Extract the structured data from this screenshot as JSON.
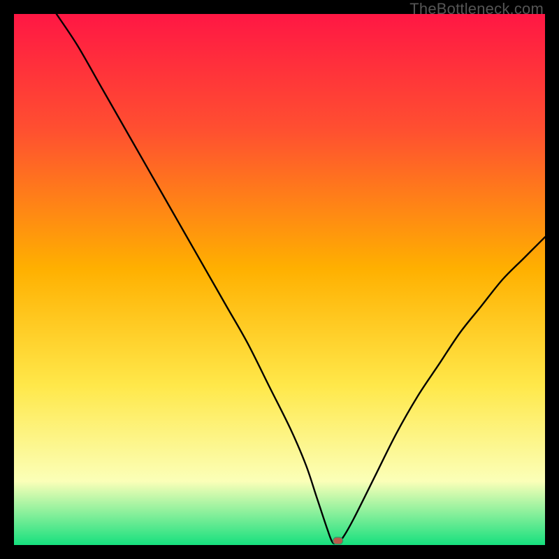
{
  "watermark": "TheBottleneck.com",
  "colors": {
    "gradient_top": "#ff1744",
    "gradient_upper": "#ff5030",
    "gradient_mid": "#ffb000",
    "gradient_lower": "#ffe84a",
    "gradient_pale": "#fbffb8",
    "gradient_bottom": "#16e07e",
    "curve": "#000000",
    "marker_fill": "#bb5b4c",
    "marker_stroke": "#2aa06b",
    "frame": "#000000"
  },
  "chart_data": {
    "type": "line",
    "title": "",
    "xlabel": "",
    "ylabel": "",
    "xlim": [
      0,
      100
    ],
    "ylim": [
      0,
      100
    ],
    "series": [
      {
        "name": "bottleneck-curve",
        "x": [
          8,
          12,
          16,
          20,
          24,
          28,
          32,
          36,
          40,
          44,
          48,
          52,
          55,
          57,
          59,
          60,
          61,
          62,
          64,
          68,
          72,
          76,
          80,
          84,
          88,
          92,
          96,
          100
        ],
        "y": [
          100,
          94,
          87,
          80,
          73,
          66,
          59,
          52,
          45,
          38,
          30,
          22,
          15,
          9,
          3,
          0.5,
          0.5,
          1.5,
          5,
          13,
          21,
          28,
          34,
          40,
          45,
          50,
          54,
          58
        ]
      }
    ],
    "flat_bottom": {
      "x_start": 58,
      "x_end": 61,
      "y": 0.5
    },
    "marker": {
      "x": 61,
      "y": 0.8
    },
    "annotations": [],
    "legend": null
  }
}
